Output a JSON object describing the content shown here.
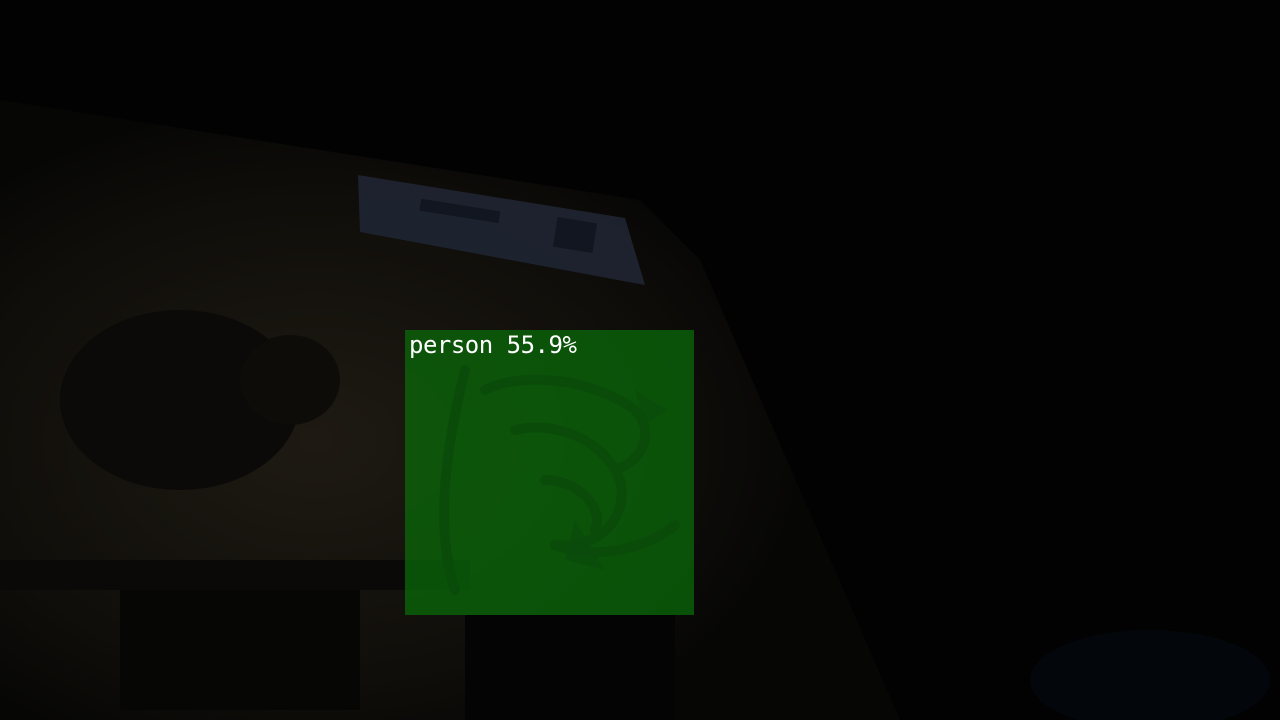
{
  "scene": {
    "background_color": "#020202",
    "surface_color": "#17140f",
    "sign_color": "#2a3040"
  },
  "detections": [
    {
      "label": "person 55.9%",
      "class": "person",
      "confidence_percent": 55.9,
      "box_color": "#0a6e0a",
      "label_color": "#ffffff"
    }
  ],
  "icons": {
    "overlay_graphic": "dragon-logo-icon"
  }
}
